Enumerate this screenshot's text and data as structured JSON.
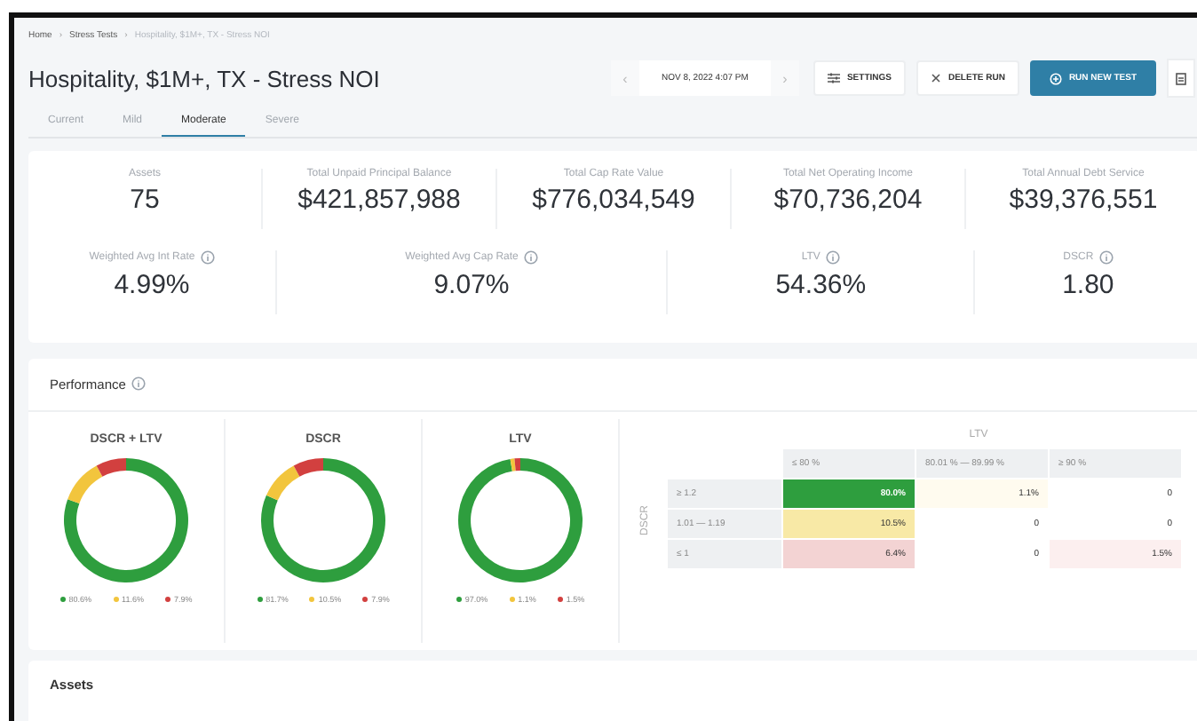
{
  "breadcrumb": [
    {
      "label": "Home",
      "separator": "›",
      "current": false
    },
    {
      "label": "Stress Tests",
      "separator": "›",
      "current": false
    },
    {
      "label": "Hospitality, $1M+, TX - Stress NOI",
      "current": true
    }
  ],
  "title": "Hospitality, $1M+, TX - Stress NOI",
  "run_picker": {
    "prev": "‹",
    "date": "NOV 8, 2022 4:07 PM",
    "next": "›"
  },
  "buttons": [
    {
      "label": "SETTINGS",
      "kind": "settings"
    },
    {
      "label": "DELETE RUN",
      "kind": "delete"
    },
    {
      "label": "RUN NEW TEST",
      "kind": "primary"
    }
  ],
  "tabs": [
    {
      "label": "Current",
      "selected": false
    },
    {
      "label": "Mild",
      "selected": false
    },
    {
      "label": "Moderate",
      "selected": true
    },
    {
      "label": "Severe",
      "selected": false
    }
  ],
  "stats_top": [
    {
      "label": "Assets",
      "value": "75"
    },
    {
      "label": "Total Unpaid Principal Balance",
      "value": "$421,857,988"
    },
    {
      "label": "Total Cap Rate Value",
      "value": "$776,034,549"
    },
    {
      "label": "Total Net Operating Income",
      "value": "$70,736,204"
    },
    {
      "label": "Total Annual Debt Service",
      "value": "$39,376,551"
    }
  ],
  "stats_bottom": [
    {
      "label": "Weighted Avg Int Rate",
      "value": "4.99%"
    },
    {
      "label": "Weighted Avg Cap Rate",
      "value": "9.07%"
    },
    {
      "label": "LTV",
      "value": "54.36%"
    },
    {
      "label": "DSCR",
      "value": "1.80"
    }
  ],
  "performance": {
    "title": "Performance",
    "donuts": [
      {
        "chart_data": {
          "type": "donut",
          "title": "DSCR + LTV",
          "values": [
            80.6,
            11.6,
            7.9
          ]
        },
        "legend": [
          {
            "label": "80.6%",
            "color": "#2e9e3e"
          },
          {
            "label": "11.6%",
            "color": "#f2c53d"
          },
          {
            "label": "7.9%",
            "color": "#d2403f"
          }
        ]
      },
      {
        "chart_data": {
          "type": "donut",
          "title": "DSCR",
          "values": [
            81.7,
            10.5,
            7.9
          ]
        },
        "legend": [
          {
            "label": "81.7%",
            "color": "#2e9e3e"
          },
          {
            "label": "10.5%",
            "color": "#f2c53d"
          },
          {
            "label": "7.9%",
            "color": "#d2403f"
          }
        ]
      },
      {
        "chart_data": {
          "type": "donut",
          "title": "LTV",
          "values": [
            97.0,
            1.1,
            1.5
          ]
        },
        "legend": [
          {
            "label": "97.0%",
            "color": "#2e9e3e"
          },
          {
            "label": "1.1%",
            "color": "#f2c53d"
          },
          {
            "label": "1.5%",
            "color": "#d2403f"
          }
        ]
      }
    ],
    "matrix": {
      "column_axis": "LTV",
      "row_axis": "DSCR",
      "columns": [
        "≤ 80 %",
        "80.01 % — 89.99 %",
        "≥ 90 %"
      ],
      "rows": [
        {
          "label": "≥ 1.2",
          "cells": [
            {
              "value": "80.0%",
              "color": "#2e9e3e"
            },
            {
              "value": "1.1%",
              "color": "#fffbef"
            },
            {
              "value": "0",
              "color": "#ffffff"
            }
          ]
        },
        {
          "label": "1.01 — 1.19",
          "cells": [
            {
              "value": "10.5%",
              "color": "#f8e9a6"
            },
            {
              "value": "0",
              "color": "#ffffff"
            },
            {
              "value": "0",
              "color": "#ffffff"
            }
          ]
        },
        {
          "label": "≤ 1",
          "cells": [
            {
              "value": "6.4%",
              "color": "#f3d3d3"
            },
            {
              "value": "0",
              "color": "#ffffff"
            },
            {
              "value": "1.5%",
              "color": "#fcefef"
            }
          ]
        }
      ]
    }
  },
  "assets_section": {
    "title": "Assets"
  }
}
